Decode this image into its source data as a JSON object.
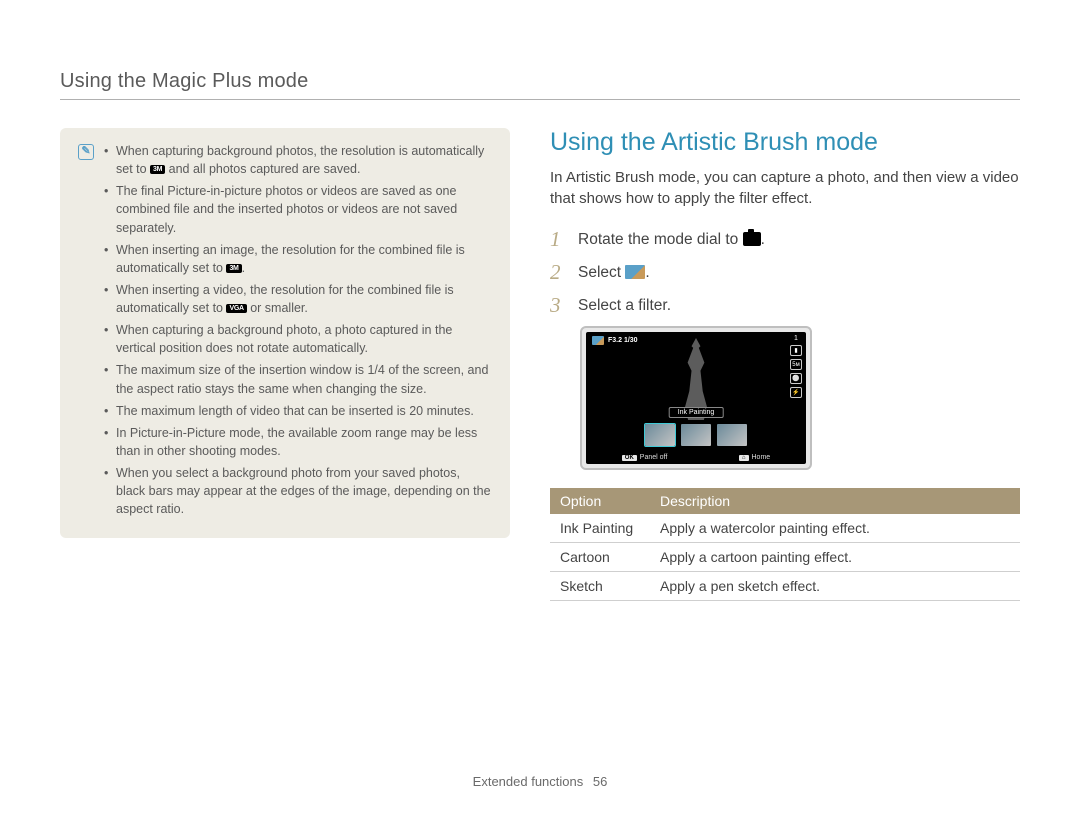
{
  "header": {
    "title": "Using the Magic Plus mode"
  },
  "notes": {
    "items": [
      {
        "pre": "When capturing background photos, the resolution is automatically set to ",
        "badge": "3M",
        "post": " and all photos captured are saved."
      },
      {
        "pre": "The final Picture-in-picture photos or videos are saved as one combined file and the inserted photos or videos are not saved separately."
      },
      {
        "pre": "When inserting an image, the resolution for the combined file is automatically set to ",
        "badge": "3M",
        "post": "."
      },
      {
        "pre": "When inserting a video, the resolution for the combined file is automatically set to ",
        "badge": "VGA",
        "post": " or smaller."
      },
      {
        "pre": "When capturing a background photo, a photo captured in the vertical position does not rotate automatically."
      },
      {
        "pre": "The maximum size of the insertion window is 1/4 of the screen, and the aspect ratio stays the same when changing the size."
      },
      {
        "pre": "The maximum length of video that can be inserted is 20 minutes."
      },
      {
        "pre": "In Picture-in-Picture mode, the available zoom range may be less than in other shooting modes."
      },
      {
        "pre": "When you select a background photo from your saved photos, black bars may appear at the edges of the image, depending on the aspect ratio."
      }
    ]
  },
  "section": {
    "title": "Using the Artistic Brush mode",
    "intro": "In Artistic Brush mode, you can capture a photo, and then view a video that shows how to apply the filter effect.",
    "steps": [
      {
        "n": "1",
        "text": "Rotate the mode dial to ",
        "icon": "camera",
        "post": "."
      },
      {
        "n": "2",
        "text": "Select ",
        "icon": "brush",
        "post": "."
      },
      {
        "n": "3",
        "text": "Select a filter."
      }
    ]
  },
  "preview": {
    "exposure": "F3.2  1/30",
    "count": "1",
    "filter_label": "Ink Painting",
    "bottom_left_key": "OK",
    "bottom_left": "Panel off",
    "bottom_right_key": "⌂",
    "bottom_right": "Home"
  },
  "table": {
    "headers": {
      "option": "Option",
      "description": "Description"
    },
    "rows": [
      {
        "option": "Ink Painting",
        "description": "Apply a watercolor painting effect."
      },
      {
        "option": "Cartoon",
        "description": "Apply a cartoon painting effect."
      },
      {
        "option": "Sketch",
        "description": "Apply a pen sketch effect."
      }
    ]
  },
  "footer": {
    "section": "Extended functions",
    "page": "56"
  }
}
